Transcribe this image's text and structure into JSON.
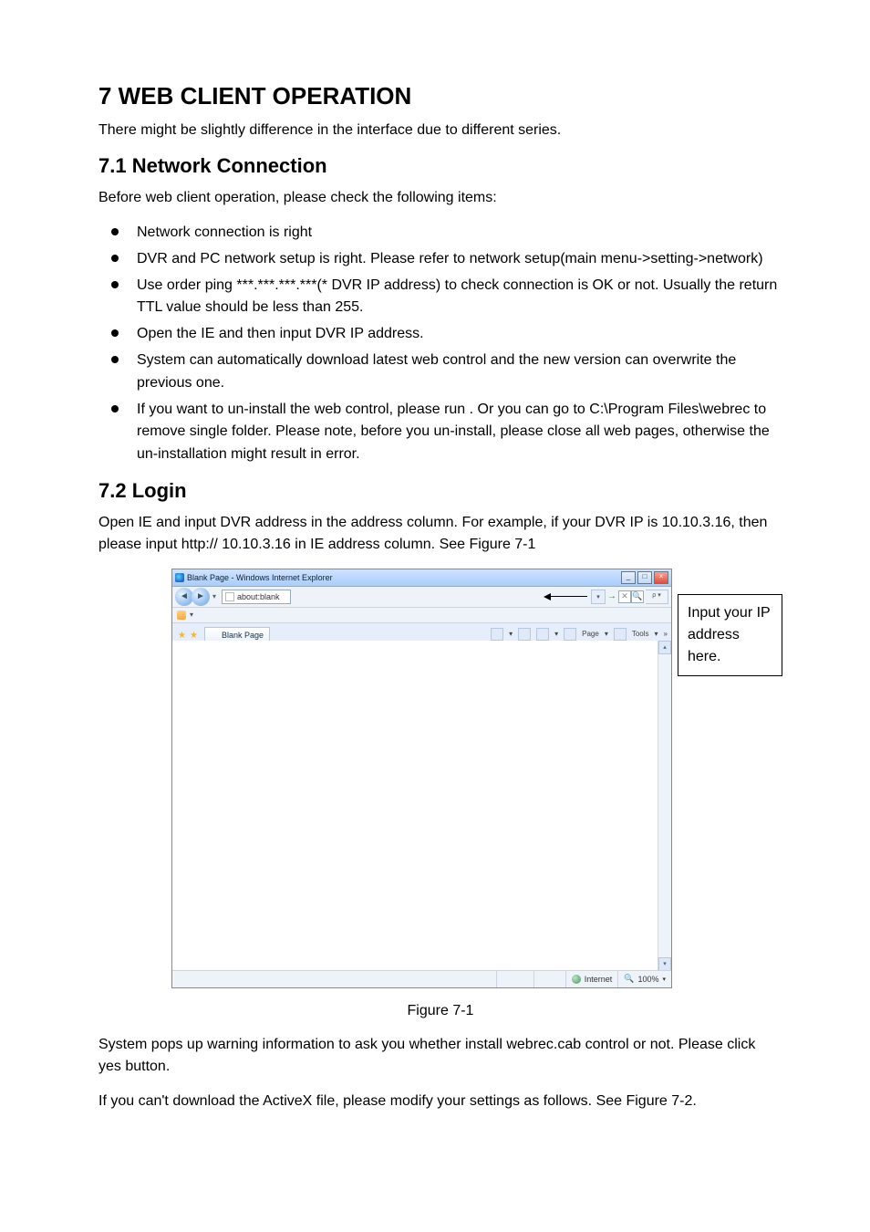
{
  "doc": {
    "h1": "7  WEB CLIENT OPERATION",
    "intro": "There might be slightly difference in the interface due to different series.",
    "s71_title": "7.1  Network Connection",
    "s71_intro": "Before web client operation, please check the following items:",
    "bullets": [
      "Network connection is right",
      "DVR and PC network setup is right. Please refer to network setup(main menu->setting->network)",
      "Use order ping ***.***.***.***(* DVR IP address) to check connection is OK or not. Usually the return TTL value should be less than 255.",
      "Open the IE and then input DVR IP address.",
      "System can automatically download latest web control and the new version can overwrite the previous one.",
      "If you want to un-install the web control, please run                                          . Or you can go to C:\\Program Files\\webrec to remove single folder. Please note, before you un-install, please close all web pages, otherwise the un-installation might result in error."
    ],
    "s72_title": "7.2  Login",
    "s72_p": "Open IE and input DVR address in the address column. For example, if your DVR IP is 10.10.3.16, then please input http:// 10.10.3.16 in IE address column. See Figure 7-1",
    "fig_caption": "Figure 7-1",
    "after1": "System pops up warning information to ask you whether install webrec.cab control or not. Please click yes button.",
    "after2": "If you can't download the ActiveX file, please modify your settings as follows. See Figure 7-2."
  },
  "browser": {
    "title": "Blank Page - Windows Internet Explorer",
    "address": "about:blank",
    "tab_label": "Blank Page",
    "toolbar_page": "Page",
    "toolbar_tools": "Tools",
    "status_zone": "Internet",
    "status_zoom": "100%",
    "search_dd": "▾",
    "go_btn": "→"
  },
  "callout": {
    "line1": "Input your IP",
    "line2": "address here."
  }
}
